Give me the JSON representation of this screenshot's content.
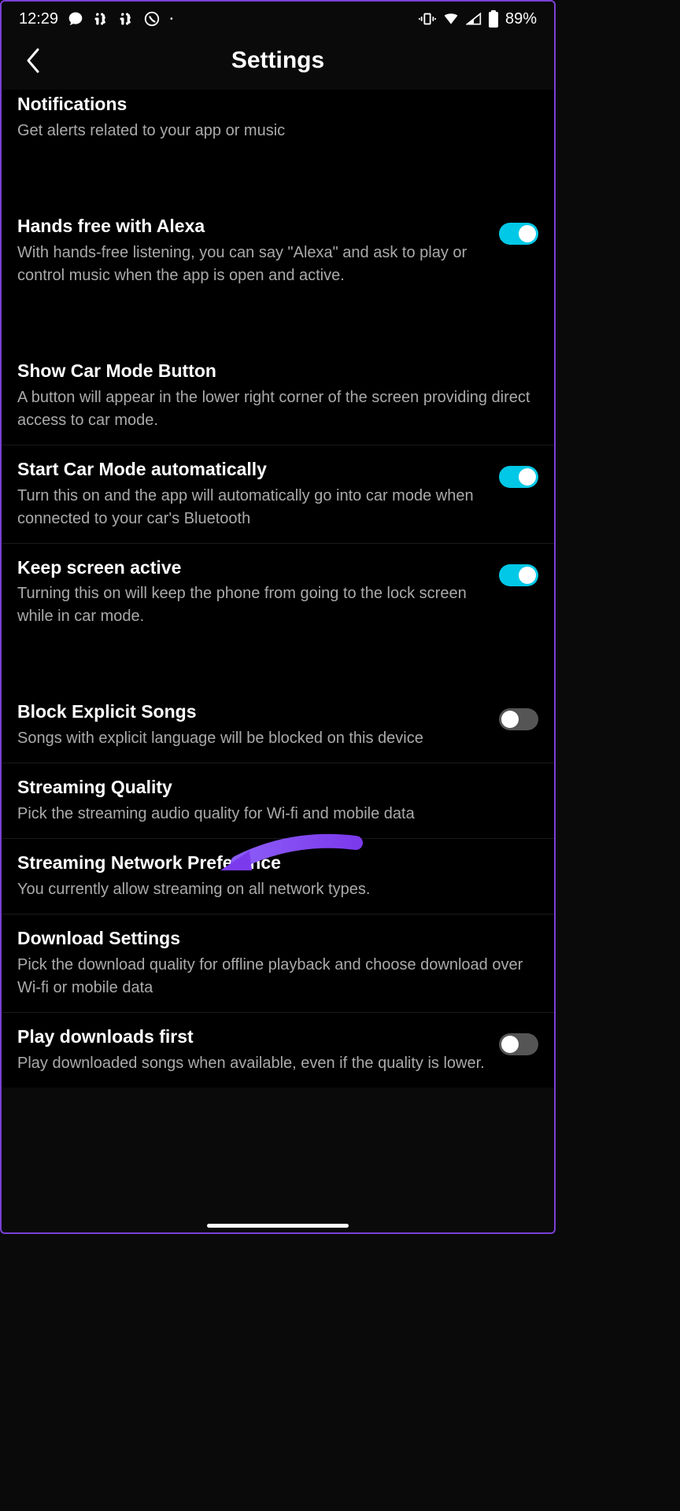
{
  "statusBar": {
    "time": "12:29",
    "battery": "89%"
  },
  "header": {
    "title": "Settings"
  },
  "settings": [
    {
      "title": "Notifications",
      "desc": "Get alerts related to your app or music",
      "hasToggle": false
    },
    {
      "title": "Hands free with Alexa",
      "desc": "With hands-free listening, you can say \"Alexa\" and ask to play or control music when the app is open and active.",
      "hasToggle": true,
      "toggleOn": true
    },
    {
      "title": "Show Car Mode Button",
      "desc": "A button will appear in the lower right corner of the screen providing direct access to car mode.",
      "hasToggle": false
    },
    {
      "title": "Start Car Mode automatically",
      "desc": "Turn this on and the app will automatically go into car mode when connected to your car's Bluetooth",
      "hasToggle": true,
      "toggleOn": true
    },
    {
      "title": "Keep screen active",
      "desc": "Turning this on will keep the phone from going to the lock screen while in car mode.",
      "hasToggle": true,
      "toggleOn": true
    },
    {
      "title": "Block Explicit Songs",
      "desc": "Songs with explicit language will be blocked on this device",
      "hasToggle": true,
      "toggleOn": false
    },
    {
      "title": "Streaming Quality",
      "desc": "Pick the streaming audio quality for Wi-fi and mobile data",
      "hasToggle": false
    },
    {
      "title": "Streaming Network Preference",
      "desc": "You currently allow streaming on all network types.",
      "hasToggle": false
    },
    {
      "title": "Download Settings",
      "desc": "Pick the download quality for offline playback and choose download over Wi-fi or mobile data",
      "hasToggle": false
    },
    {
      "title": "Play downloads first",
      "desc": "Play downloaded songs when available, even if the quality is lower.",
      "hasToggle": true,
      "toggleOn": false
    }
  ]
}
